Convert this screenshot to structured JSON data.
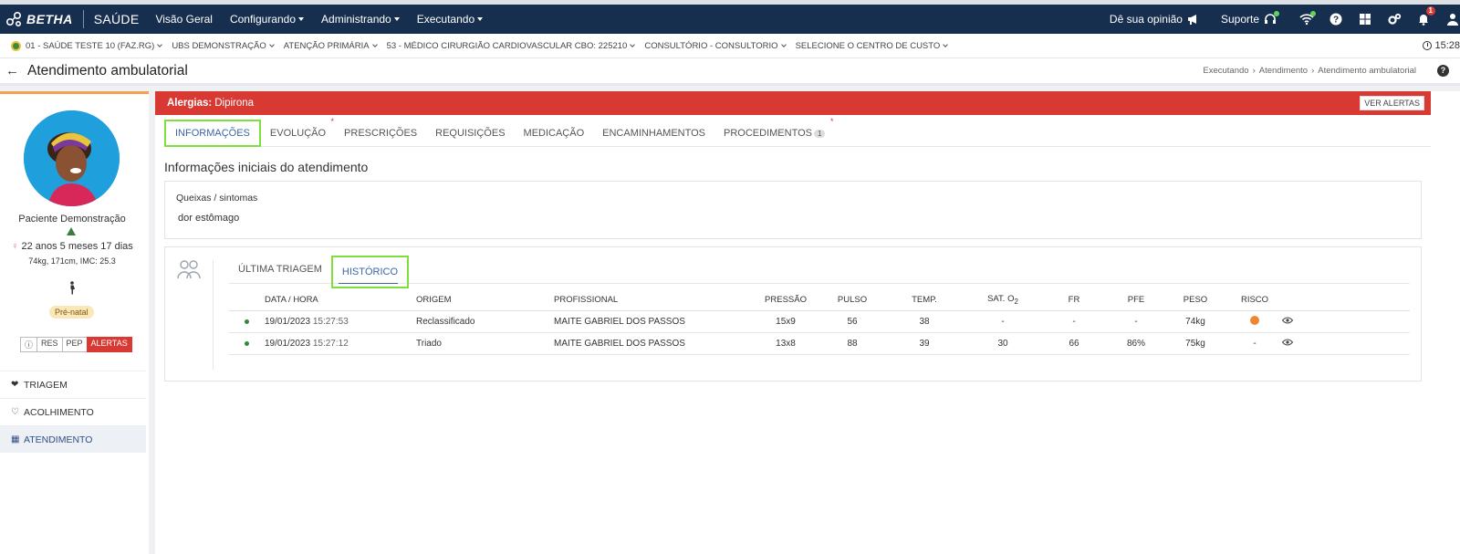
{
  "navbar": {
    "brand": "BETHA",
    "product": "SAÚDE",
    "menu": [
      {
        "label": "Visão Geral",
        "dropdown": false
      },
      {
        "label": "Configurando",
        "dropdown": true
      },
      {
        "label": "Administrando",
        "dropdown": true
      },
      {
        "label": "Executando",
        "dropdown": true
      }
    ],
    "opinion": "Dê sua opinião",
    "support": "Suporte",
    "notification_count": "1"
  },
  "context": {
    "items": [
      "01 - SAÚDE TESTE 10 (FAZ.RG)",
      "UBS DEMONSTRAÇÃO",
      "ATENÇÃO PRIMÁRIA",
      "53 - MÉDICO CIRURGIÃO CARDIOVASCULAR CBO: 225210",
      "CONSULTÓRIO - CONSULTORIO",
      "SELECIONE O CENTRO DE CUSTO"
    ],
    "clock": "15:28"
  },
  "page": {
    "title": "Atendimento ambulatorial",
    "breadcrumb": [
      "Executando",
      "Atendimento",
      "Atendimento ambulatorial"
    ]
  },
  "patient": {
    "name": "Paciente Demonstração",
    "age": "22 anos 5 meses 17 dias",
    "bio": "74kg, 171cm, IMC: 25.3",
    "tag": "Pré-natal",
    "buttons": [
      "RES",
      "PEP",
      "ALERTAS"
    ]
  },
  "sidemenu": [
    {
      "label": "TRIAGEM",
      "icon": "heartbeat-icon"
    },
    {
      "label": "ACOLHIMENTO",
      "icon": "heart-icon"
    },
    {
      "label": "ATENDIMENTO",
      "icon": "clipboard-icon"
    }
  ],
  "allergy": {
    "label": "Alergias:",
    "value": "Dipirona",
    "button": "VER ALERTAS"
  },
  "tabs": [
    {
      "label": "INFORMAÇÕES",
      "active": true,
      "required": false
    },
    {
      "label": "EVOLUÇÃO",
      "active": false,
      "required": true
    },
    {
      "label": "PRESCRIÇÕES",
      "active": false,
      "required": false
    },
    {
      "label": "REQUISIÇÕES",
      "active": false,
      "required": false
    },
    {
      "label": "MEDICAÇÃO",
      "active": false,
      "required": false
    },
    {
      "label": "ENCAMINHAMENTOS",
      "active": false,
      "required": false
    },
    {
      "label": "PROCEDIMENTOS",
      "active": false,
      "required": true,
      "badge": "1"
    }
  ],
  "section_title": "Informações iniciais do atendimento",
  "queixas": {
    "label": "Queixas / sintomas",
    "value": "dor estômago"
  },
  "history": {
    "tabs": [
      {
        "label": "ÚLTIMA TRIAGEM",
        "active": false
      },
      {
        "label": "HISTÓRICO",
        "active": true
      }
    ],
    "columns": [
      "DATA / HORA",
      "ORIGEM",
      "PROFISSIONAL",
      "PRESSÃO",
      "PULSO",
      "TEMP.",
      "SAT. O",
      "FR",
      "PFE",
      "PESO",
      "RISCO"
    ],
    "sat_subscript": "2",
    "rows": [
      {
        "date": "19/01/2023",
        "time": "15:27:53",
        "origem": "Reclassificado",
        "profissional": "MAITE GABRIEL DOS PASSOS",
        "pressao": "15x9",
        "pulso": "56",
        "temp": "38",
        "sat": "-",
        "fr": "-",
        "pfe": "-",
        "peso": "74kg",
        "risco_color": "#ef8732",
        "risco": ""
      },
      {
        "date": "19/01/2023",
        "time": "15:27:12",
        "origem": "Triado",
        "profissional": "MAITE GABRIEL DOS PASSOS",
        "pressao": "13x8",
        "pulso": "88",
        "temp": "39",
        "sat": "30",
        "fr": "66",
        "pfe": "86%",
        "peso": "75kg",
        "risco_color": "",
        "risco": "-"
      }
    ]
  }
}
